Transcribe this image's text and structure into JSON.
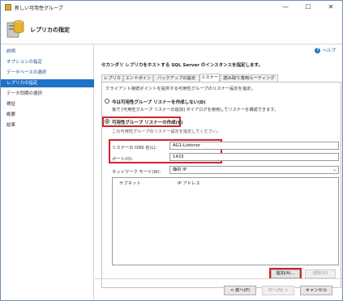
{
  "window": {
    "title": "新しい可用性グループ",
    "minimize": "—",
    "maximize": "☐",
    "close": "✕"
  },
  "header": {
    "heading": "レプリカの指定"
  },
  "sidebar": {
    "items": [
      {
        "label": "説明"
      },
      {
        "label": "オプションの指定"
      },
      {
        "label": "データベースの選択"
      },
      {
        "label": "レプリカの指定"
      },
      {
        "label": "データ同期の選択"
      },
      {
        "label": "検証"
      },
      {
        "label": "概要"
      },
      {
        "label": "結果"
      }
    ]
  },
  "main": {
    "help": "ヘルプ",
    "instruction": "セカンダリ レプリカをホストする SQL Server のインスタンスを指定します。",
    "tabs": [
      {
        "label": "レプリカ"
      },
      {
        "label": "エンドポイント"
      },
      {
        "label": "バックアップの設定"
      },
      {
        "label": "リスナー"
      },
      {
        "label": "読み取り専用ルーティング"
      }
    ],
    "tab_description": "クライアント接続ポイントを提供する可用性グループのリスナー設定を指定。",
    "option1": {
      "label": "今は可用性グループ リスナーを作成しない(D)",
      "desc": "後で [可用性グループ リスナーの追加] ダイアログを使用してリスナーを構成できます。"
    },
    "option2": {
      "label": "可用性グループ リスナーの作成(C)",
      "desc": "この可用性グループのリスナー設定を指定してください。"
    },
    "dns_label": "リスナーの DNS 名(L):",
    "dns_value": "AG1-Listener",
    "port_label": "ポート(O):",
    "port_value": "1433",
    "netmode_label": "ネットワーク モード(W):",
    "netmode_value": "静的 IP",
    "grid_headers": [
      "サブネット",
      "IP アドレス"
    ],
    "add_button": "追加(A)...",
    "remove_button": "削除(V)"
  },
  "footer": {
    "prev": "< 前へ(P)",
    "next": "次へ(N) >",
    "cancel": "キャンセル"
  }
}
